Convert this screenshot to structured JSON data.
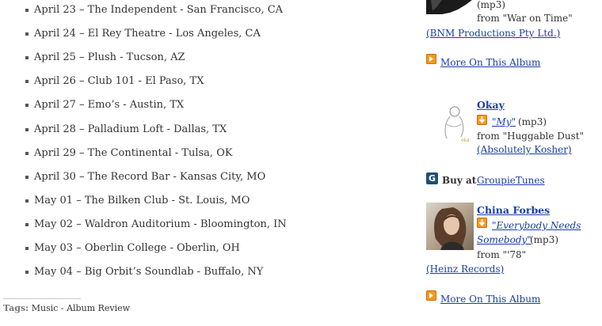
{
  "tour_dates": [
    "April 23 – The Independent - San Francisco, CA",
    "April 24 – El Rey Theatre - Los Angeles, CA",
    "April 25 – Plush - Tucson, AZ",
    "April 26 – Club 101 - El Paso, TX",
    "April 27 – Emo’s - Austin, TX",
    "April 28 – Palladium Loft - Dallas, TX",
    "April 29 – The Continental - Tulsa, OK",
    "April 30 – The Record Bar - Kansas City, MO",
    "May 01 – The Bilken Club - St. Louis, MO",
    "May 02 – Waldron Auditorium - Bloomington, IN",
    "May 03 – Oberlin College - Oberlin, OH",
    "May 04 – Big Orbit’s Soundlab - Buffalo, NY"
  ],
  "tags": {
    "label": "Tags:",
    "value": "Music - Album Review"
  },
  "sidebar": {
    "top_entry": {
      "format": "(mp3)",
      "from": "from \"War on Time\"",
      "label": "(BNM Productions Pty Ltd.)",
      "more_link": "More On This Album"
    },
    "okay_entry": {
      "artist": "Okay",
      "track": "\"My\"",
      "format": "(mp3)",
      "from": "from \"Huggable Dust\"",
      "label": "(Absolutely Kosher)",
      "buy_prefix": "Buy at",
      "buy_store": "GroupieTunes"
    },
    "china_entry": {
      "artist": "China Forbes",
      "track_line1": "\"Everybody Needs",
      "track_line2": "Somebody\"",
      "format": "(mp3)",
      "from": "from \"'78\"",
      "label": "(Heinz Records)",
      "more_link": "More On This Album"
    }
  },
  "colors": {
    "link": "#1a3ea8",
    "icon_orange": "#f39a1e",
    "icon_g": "#1e4f74",
    "text": "#333333"
  }
}
